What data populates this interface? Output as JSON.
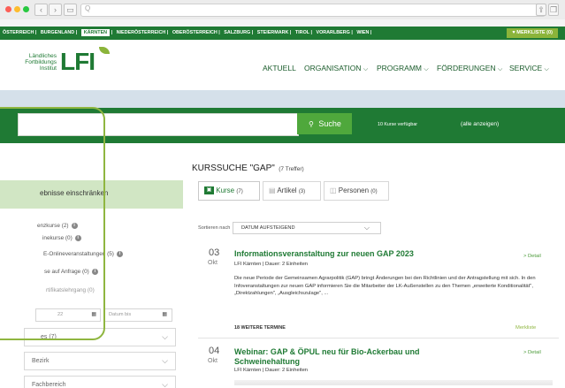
{
  "browser": {
    "url": "Q"
  },
  "regions": [
    "ÖSTERREICH",
    "BURGENLAND",
    "KÄRNTEN",
    "NIEDERÖSTERREICH",
    "OBERÖSTERREICH",
    "SALZBURG",
    "STEIERMARK",
    "TIROL",
    "VORARLBERG",
    "WIEN"
  ],
  "active_region": "KÄRNTEN",
  "merkliste": "♥ MERKLISTE (0)",
  "logo": {
    "line1": "Ländliches",
    "line2": "Fortbildungs",
    "line3": "Institut",
    "mark": "LFI"
  },
  "nav": [
    "AKTUELL",
    "ORGANISATION",
    "PROGRAMM",
    "FÖRDERUNGEN",
    "SERVICE"
  ],
  "search": {
    "button": "Suche",
    "count_text": "10 Kurse verfügbar",
    "show_all": "(alle anzeigen)"
  },
  "sidebar": {
    "heading": "ebnisse einschränken",
    "filters": [
      "enzkurse (2)",
      "inekurse (0)",
      "E-Onlineveranstaltungen (5)",
      "se auf Anfrage (0)",
      "rtifikatslehrgang (0)"
    ],
    "date_from": "22",
    "date_to": "Datum bis",
    "dropdowns": [
      "es (7)",
      "Bezirk",
      "Fachbereich"
    ]
  },
  "main": {
    "title": "KURSSUCHE \"GAP\"",
    "title_count": "(7 Treffer)",
    "tabs": [
      {
        "label": "Kurse",
        "count": "(7)"
      },
      {
        "label": "Artikel",
        "count": "(3)"
      },
      {
        "label": "Personen",
        "count": "(0)"
      }
    ],
    "sort_label": "Sortieren nach",
    "sort_value": "DATUM AUFSTEIGEND",
    "events": [
      {
        "day": "03",
        "month": "Okt",
        "title": "Informationsveranstaltung zur neuen GAP 2023",
        "sub": "LFI Kärnten | Dauer: 2 Einheiten",
        "detail": "> Detail",
        "desc": "Die neue Periode der Gemeinsamen Agrarpolitik (GAP) bringt Änderungen bei den Richtlinien und der Antragstellung mit sich. In den Infoveranstaltungen zur neuen GAP informieren Sie die Mitarbeiter der LK-Außenstellen zu den Themen „erweiterte Konditionalität\", „Direktzahlungen\", „Ausgleichszulage\", ...",
        "more": "18 WEITERE TERMINE",
        "merkliste": "Merkliste"
      },
      {
        "day": "04",
        "month": "Okt",
        "title1": "Webinar: GAP & ÖPUL neu für Bio-Ackerbau und",
        "title2": "Schweinehaltung",
        "sub": "LFI Kärnten | Dauer: 2 Einheiten",
        "detail": "> Detail"
      }
    ]
  },
  "colors": {
    "green": "#1f7a34",
    "light_green": "#4fa83c",
    "accent": "#8fb640"
  }
}
